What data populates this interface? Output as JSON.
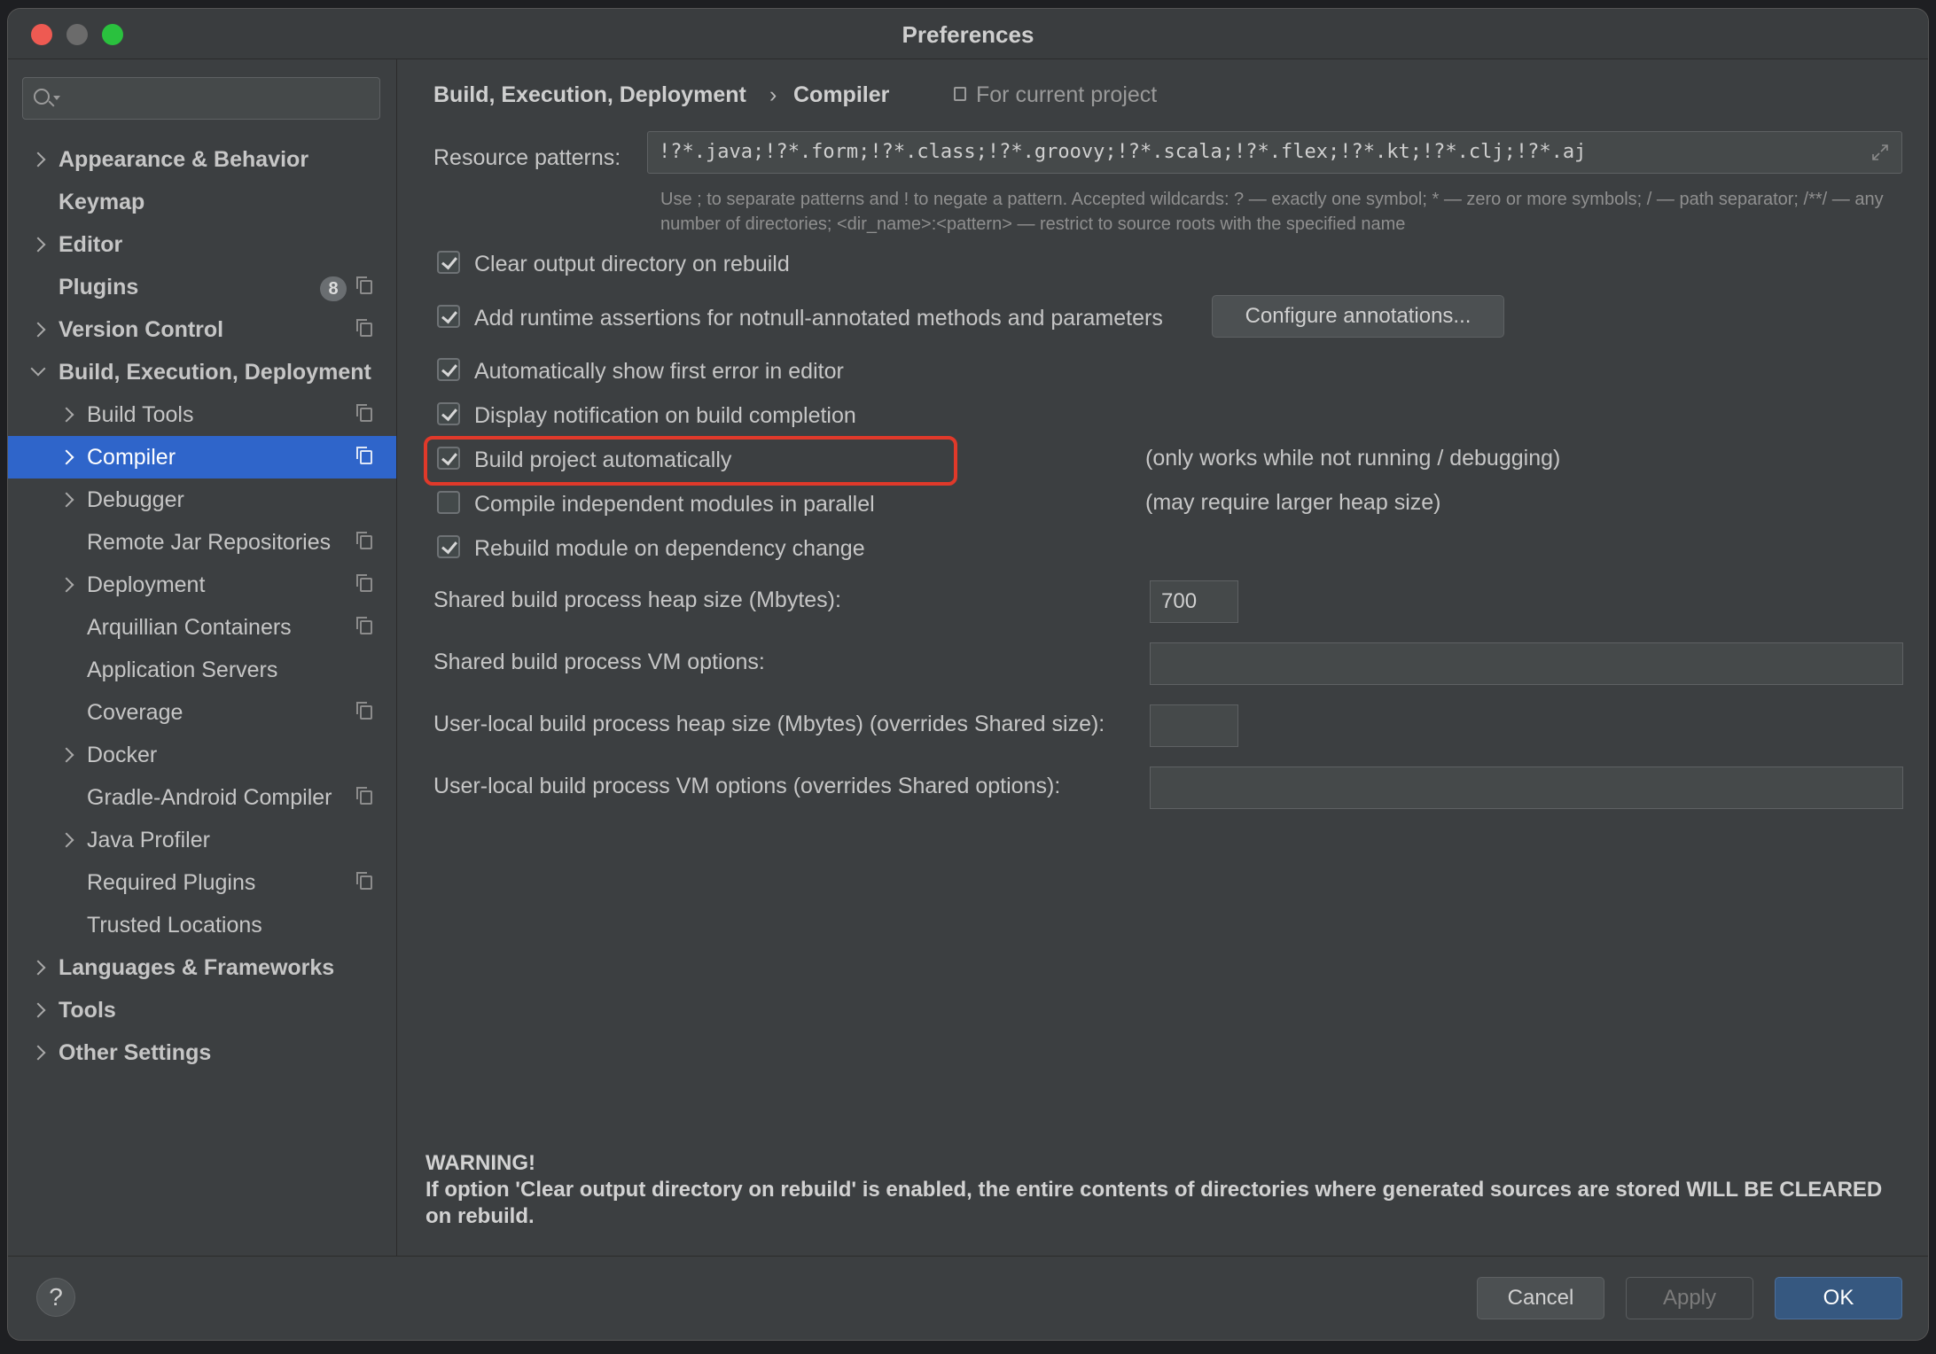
{
  "window": {
    "title": "Preferences"
  },
  "sidebar": {
    "search_placeholder": "",
    "items": [
      {
        "label": "Appearance & Behavior"
      },
      {
        "label": "Keymap"
      },
      {
        "label": "Editor"
      },
      {
        "label": "Plugins",
        "badge": "8"
      },
      {
        "label": "Version Control"
      },
      {
        "label": "Build, Execution, Deployment"
      },
      {
        "label": "Build Tools"
      },
      {
        "label": "Compiler"
      },
      {
        "label": "Debugger"
      },
      {
        "label": "Remote Jar Repositories"
      },
      {
        "label": "Deployment"
      },
      {
        "label": "Arquillian Containers"
      },
      {
        "label": "Application Servers"
      },
      {
        "label": "Coverage"
      },
      {
        "label": "Docker"
      },
      {
        "label": "Gradle-Android Compiler"
      },
      {
        "label": "Java Profiler"
      },
      {
        "label": "Required Plugins"
      },
      {
        "label": "Trusted Locations"
      },
      {
        "label": "Languages & Frameworks"
      },
      {
        "label": "Tools"
      },
      {
        "label": "Other Settings"
      }
    ]
  },
  "breadcrumb": {
    "parent": "Build, Execution, Deployment",
    "separator": "›",
    "current": "Compiler",
    "scope": "For current project"
  },
  "compiler": {
    "resource_patterns_label": "Resource patterns:",
    "resource_patterns_value": "!?*.java;!?*.form;!?*.class;!?*.groovy;!?*.scala;!?*.flex;!?*.kt;!?*.clj;!?*.aj",
    "hint_text": "Use ; to separate patterns and ! to negate a pattern. Accepted wildcards: ? — exactly one symbol; * — zero or more symbols; / — path separator; /**/ — any number of directories; <dir_name>:<pattern> — restrict to source roots with the specified name",
    "options": [
      {
        "label": "Clear output directory on rebuild",
        "checked": true
      },
      {
        "label": "Add runtime assertions for notnull-annotated methods and parameters",
        "checked": true
      },
      {
        "label": "Automatically show first error in editor",
        "checked": true
      },
      {
        "label": "Display notification on build completion",
        "checked": true
      },
      {
        "label": "Build project automatically",
        "checked": true
      },
      {
        "label": "Compile independent modules in parallel",
        "checked": false
      },
      {
        "label": "Rebuild module on dependency change",
        "checked": true
      }
    ],
    "configure_annotations": "Configure annotations...",
    "note_build_auto": "(only works while not running / debugging)",
    "note_parallel": "(may require larger heap size)",
    "heap_label": "Shared build process heap size (Mbytes):",
    "heap_value": "700",
    "vm_label": "Shared build process VM options:",
    "vm_value": "",
    "user_heap_label": "User-local build process heap size (Mbytes) (overrides Shared size):",
    "user_heap_value": "",
    "user_vm_label": "User-local build process VM options (overrides Shared options):",
    "user_vm_value": "",
    "warning_title": "WARNING!",
    "warning_text": "If option 'Clear output directory on rebuild' is enabled, the entire contents of directories where generated sources are stored WILL BE CLEARED on rebuild."
  },
  "footer": {
    "help": "?",
    "cancel": "Cancel",
    "apply": "Apply",
    "ok": "OK"
  }
}
